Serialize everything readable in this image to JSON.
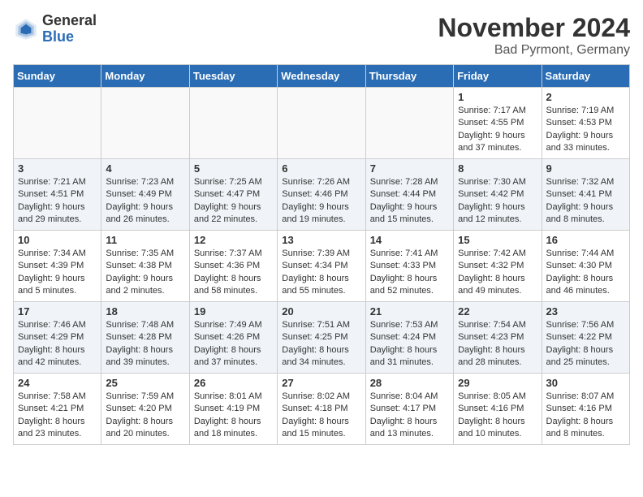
{
  "header": {
    "logo_general": "General",
    "logo_blue": "Blue",
    "month_title": "November 2024",
    "location": "Bad Pyrmont, Germany"
  },
  "days_of_week": [
    "Sunday",
    "Monday",
    "Tuesday",
    "Wednesday",
    "Thursday",
    "Friday",
    "Saturday"
  ],
  "weeks": [
    [
      {
        "day": "",
        "sunrise": "",
        "sunset": "",
        "daylight": ""
      },
      {
        "day": "",
        "sunrise": "",
        "sunset": "",
        "daylight": ""
      },
      {
        "day": "",
        "sunrise": "",
        "sunset": "",
        "daylight": ""
      },
      {
        "day": "",
        "sunrise": "",
        "sunset": "",
        "daylight": ""
      },
      {
        "day": "",
        "sunrise": "",
        "sunset": "",
        "daylight": ""
      },
      {
        "day": "1",
        "sunrise": "Sunrise: 7:17 AM",
        "sunset": "Sunset: 4:55 PM",
        "daylight": "Daylight: 9 hours and 37 minutes."
      },
      {
        "day": "2",
        "sunrise": "Sunrise: 7:19 AM",
        "sunset": "Sunset: 4:53 PM",
        "daylight": "Daylight: 9 hours and 33 minutes."
      }
    ],
    [
      {
        "day": "3",
        "sunrise": "Sunrise: 7:21 AM",
        "sunset": "Sunset: 4:51 PM",
        "daylight": "Daylight: 9 hours and 29 minutes."
      },
      {
        "day": "4",
        "sunrise": "Sunrise: 7:23 AM",
        "sunset": "Sunset: 4:49 PM",
        "daylight": "Daylight: 9 hours and 26 minutes."
      },
      {
        "day": "5",
        "sunrise": "Sunrise: 7:25 AM",
        "sunset": "Sunset: 4:47 PM",
        "daylight": "Daylight: 9 hours and 22 minutes."
      },
      {
        "day": "6",
        "sunrise": "Sunrise: 7:26 AM",
        "sunset": "Sunset: 4:46 PM",
        "daylight": "Daylight: 9 hours and 19 minutes."
      },
      {
        "day": "7",
        "sunrise": "Sunrise: 7:28 AM",
        "sunset": "Sunset: 4:44 PM",
        "daylight": "Daylight: 9 hours and 15 minutes."
      },
      {
        "day": "8",
        "sunrise": "Sunrise: 7:30 AM",
        "sunset": "Sunset: 4:42 PM",
        "daylight": "Daylight: 9 hours and 12 minutes."
      },
      {
        "day": "9",
        "sunrise": "Sunrise: 7:32 AM",
        "sunset": "Sunset: 4:41 PM",
        "daylight": "Daylight: 9 hours and 8 minutes."
      }
    ],
    [
      {
        "day": "10",
        "sunrise": "Sunrise: 7:34 AM",
        "sunset": "Sunset: 4:39 PM",
        "daylight": "Daylight: 9 hours and 5 minutes."
      },
      {
        "day": "11",
        "sunrise": "Sunrise: 7:35 AM",
        "sunset": "Sunset: 4:38 PM",
        "daylight": "Daylight: 9 hours and 2 minutes."
      },
      {
        "day": "12",
        "sunrise": "Sunrise: 7:37 AM",
        "sunset": "Sunset: 4:36 PM",
        "daylight": "Daylight: 8 hours and 58 minutes."
      },
      {
        "day": "13",
        "sunrise": "Sunrise: 7:39 AM",
        "sunset": "Sunset: 4:34 PM",
        "daylight": "Daylight: 8 hours and 55 minutes."
      },
      {
        "day": "14",
        "sunrise": "Sunrise: 7:41 AM",
        "sunset": "Sunset: 4:33 PM",
        "daylight": "Daylight: 8 hours and 52 minutes."
      },
      {
        "day": "15",
        "sunrise": "Sunrise: 7:42 AM",
        "sunset": "Sunset: 4:32 PM",
        "daylight": "Daylight: 8 hours and 49 minutes."
      },
      {
        "day": "16",
        "sunrise": "Sunrise: 7:44 AM",
        "sunset": "Sunset: 4:30 PM",
        "daylight": "Daylight: 8 hours and 46 minutes."
      }
    ],
    [
      {
        "day": "17",
        "sunrise": "Sunrise: 7:46 AM",
        "sunset": "Sunset: 4:29 PM",
        "daylight": "Daylight: 8 hours and 42 minutes."
      },
      {
        "day": "18",
        "sunrise": "Sunrise: 7:48 AM",
        "sunset": "Sunset: 4:28 PM",
        "daylight": "Daylight: 8 hours and 39 minutes."
      },
      {
        "day": "19",
        "sunrise": "Sunrise: 7:49 AM",
        "sunset": "Sunset: 4:26 PM",
        "daylight": "Daylight: 8 hours and 37 minutes."
      },
      {
        "day": "20",
        "sunrise": "Sunrise: 7:51 AM",
        "sunset": "Sunset: 4:25 PM",
        "daylight": "Daylight: 8 hours and 34 minutes."
      },
      {
        "day": "21",
        "sunrise": "Sunrise: 7:53 AM",
        "sunset": "Sunset: 4:24 PM",
        "daylight": "Daylight: 8 hours and 31 minutes."
      },
      {
        "day": "22",
        "sunrise": "Sunrise: 7:54 AM",
        "sunset": "Sunset: 4:23 PM",
        "daylight": "Daylight: 8 hours and 28 minutes."
      },
      {
        "day": "23",
        "sunrise": "Sunrise: 7:56 AM",
        "sunset": "Sunset: 4:22 PM",
        "daylight": "Daylight: 8 hours and 25 minutes."
      }
    ],
    [
      {
        "day": "24",
        "sunrise": "Sunrise: 7:58 AM",
        "sunset": "Sunset: 4:21 PM",
        "daylight": "Daylight: 8 hours and 23 minutes."
      },
      {
        "day": "25",
        "sunrise": "Sunrise: 7:59 AM",
        "sunset": "Sunset: 4:20 PM",
        "daylight": "Daylight: 8 hours and 20 minutes."
      },
      {
        "day": "26",
        "sunrise": "Sunrise: 8:01 AM",
        "sunset": "Sunset: 4:19 PM",
        "daylight": "Daylight: 8 hours and 18 minutes."
      },
      {
        "day": "27",
        "sunrise": "Sunrise: 8:02 AM",
        "sunset": "Sunset: 4:18 PM",
        "daylight": "Daylight: 8 hours and 15 minutes."
      },
      {
        "day": "28",
        "sunrise": "Sunrise: 8:04 AM",
        "sunset": "Sunset: 4:17 PM",
        "daylight": "Daylight: 8 hours and 13 minutes."
      },
      {
        "day": "29",
        "sunrise": "Sunrise: 8:05 AM",
        "sunset": "Sunset: 4:16 PM",
        "daylight": "Daylight: 8 hours and 10 minutes."
      },
      {
        "day": "30",
        "sunrise": "Sunrise: 8:07 AM",
        "sunset": "Sunset: 4:16 PM",
        "daylight": "Daylight: 8 hours and 8 minutes."
      }
    ]
  ]
}
